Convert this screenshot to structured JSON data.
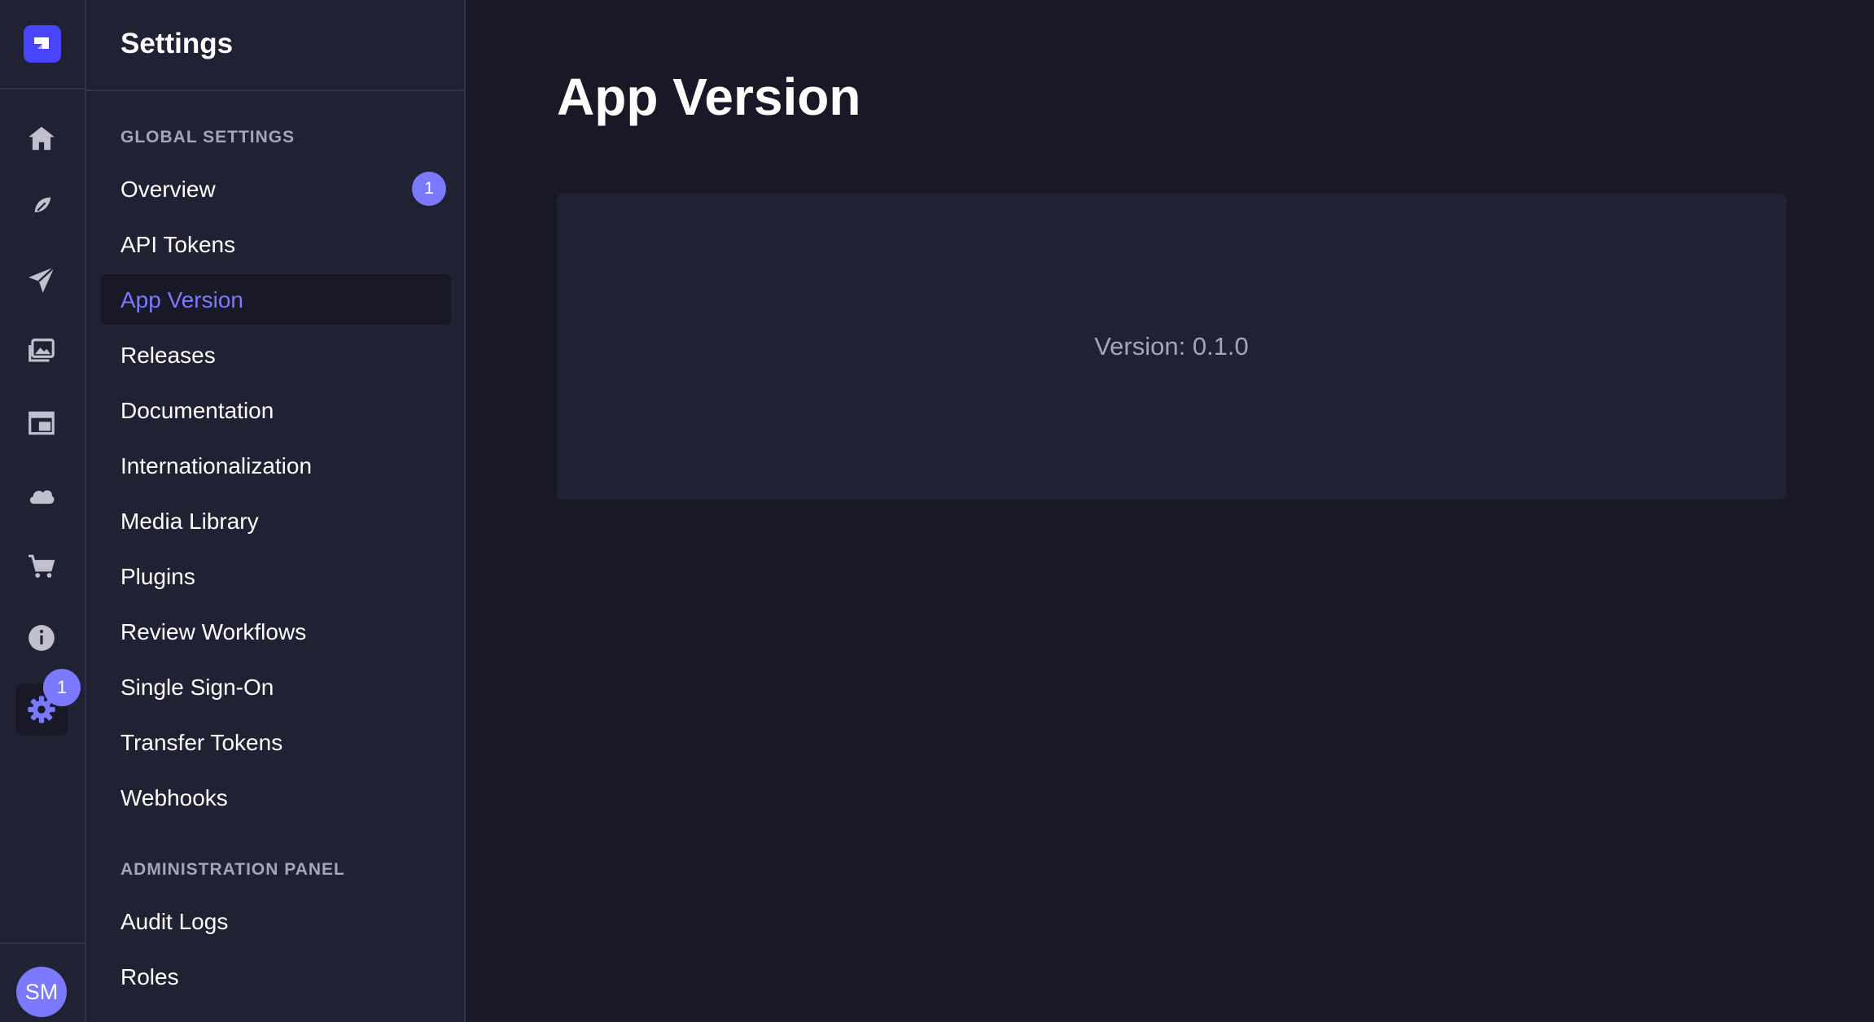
{
  "rail": {
    "items": [
      {
        "name": "home-icon"
      },
      {
        "name": "feather-icon"
      },
      {
        "name": "paper-plane-icon"
      },
      {
        "name": "images-icon"
      },
      {
        "name": "layout-icon"
      },
      {
        "name": "cloud-icon"
      },
      {
        "name": "cart-icon"
      },
      {
        "name": "info-icon"
      },
      {
        "name": "gear-icon"
      }
    ],
    "settings_badge": "1",
    "avatar_initials": "SM"
  },
  "subnav": {
    "title": "Settings",
    "global_section": {
      "label": "GLOBAL SETTINGS",
      "items": [
        {
          "label": "Overview",
          "badge": "1"
        },
        {
          "label": "API Tokens"
        },
        {
          "label": "App Version",
          "active": true
        },
        {
          "label": "Releases"
        },
        {
          "label": "Documentation"
        },
        {
          "label": "Internationalization"
        },
        {
          "label": "Media Library"
        },
        {
          "label": "Plugins"
        },
        {
          "label": "Review Workflows"
        },
        {
          "label": "Single Sign-On"
        },
        {
          "label": "Transfer Tokens"
        },
        {
          "label": "Webhooks"
        }
      ]
    },
    "admin_section": {
      "label": "ADMINISTRATION PANEL",
      "items": [
        {
          "label": "Audit Logs"
        },
        {
          "label": "Roles"
        }
      ]
    }
  },
  "main": {
    "title": "App Version",
    "version_text": "Version: 0.1.0"
  },
  "colors": {
    "accent": "#7b79ff",
    "brand": "#4945ff",
    "background": "#181826",
    "panel": "#212134"
  }
}
